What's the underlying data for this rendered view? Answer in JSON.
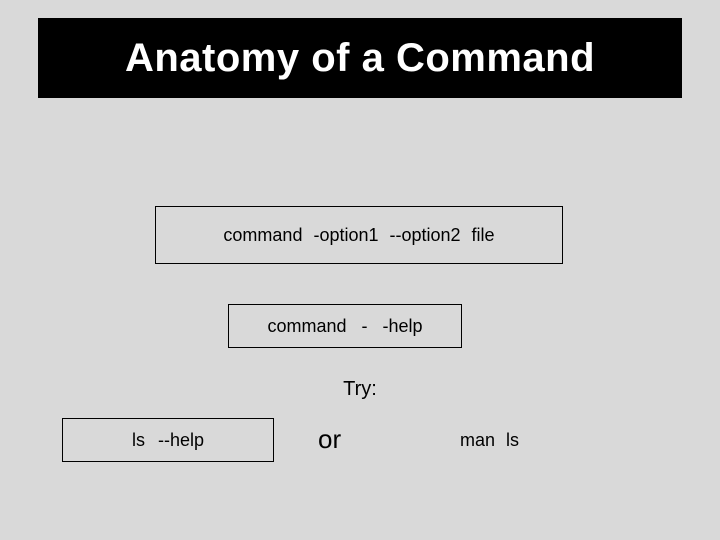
{
  "title": "Anatomy of a Command",
  "box1": "command  -option1  --option2   file",
  "box2": "command   - -help",
  "try": "Try:",
  "box3": "ls  --help",
  "or": "or",
  "man": "man  ls"
}
